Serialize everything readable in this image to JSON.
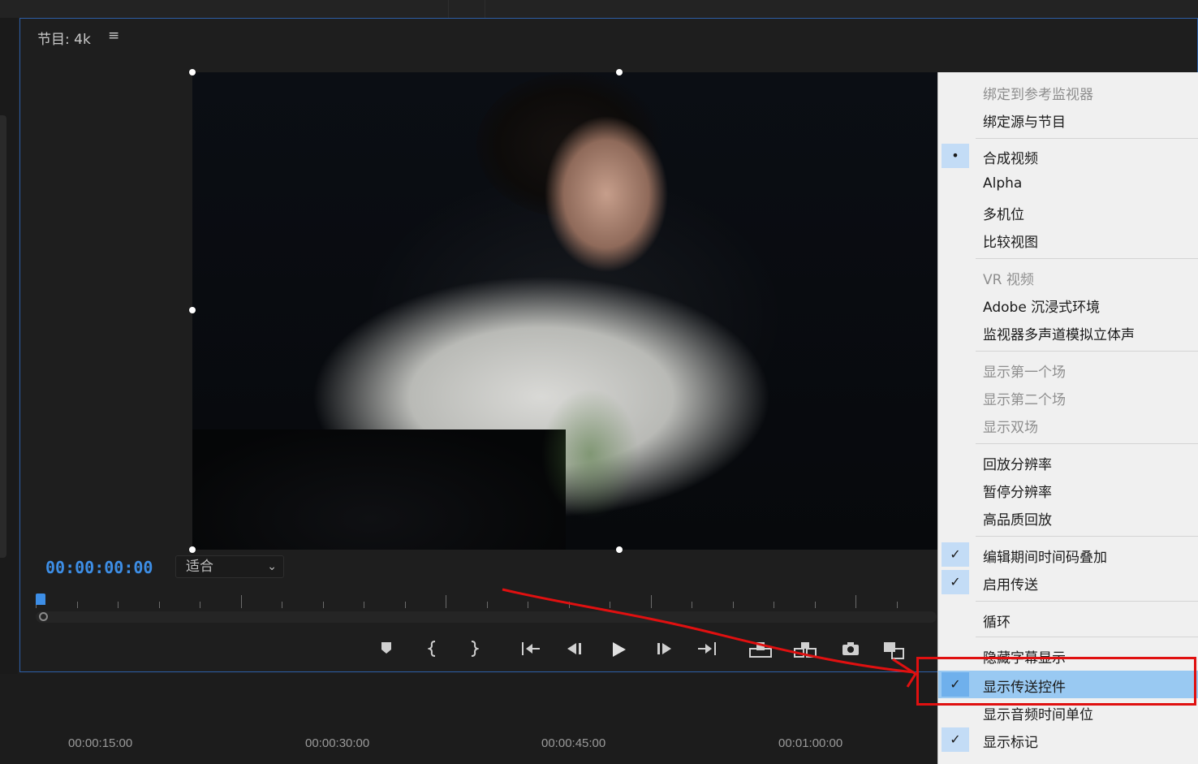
{
  "panel": {
    "title": "节目: 4k",
    "menu_icon": "≡"
  },
  "monitor": {
    "timecode": "00:00:00:00",
    "fit_label": "适合",
    "fit_chevron": "chevron-down-icon"
  },
  "controls": [
    {
      "name": "add-marker-button",
      "icon": "marker-icon"
    },
    {
      "name": "mark-in-button",
      "icon": "mark-in-icon"
    },
    {
      "name": "mark-out-button",
      "icon": "mark-out-icon"
    },
    {
      "name": "go-to-in-button",
      "icon": "go-to-in-icon"
    },
    {
      "name": "step-back-button",
      "icon": "step-back-icon"
    },
    {
      "name": "play-button",
      "icon": "play-icon"
    },
    {
      "name": "step-forward-button",
      "icon": "step-forward-icon"
    },
    {
      "name": "go-to-out-button",
      "icon": "go-to-out-icon"
    },
    {
      "name": "lift-button",
      "icon": "lift-icon"
    },
    {
      "name": "extract-button",
      "icon": "extract-icon"
    },
    {
      "name": "export-frame-button",
      "icon": "camera-icon"
    },
    {
      "name": "comparison-view-button",
      "icon": "comparison-view-icon"
    }
  ],
  "timeline": {
    "labels": [
      "00:00:15:00",
      "00:00:30:00",
      "00:00:45:00",
      "00:01:00:00"
    ]
  },
  "context_menu": {
    "items": [
      {
        "label": "绑定到参考监视器",
        "disabled": true
      },
      {
        "label": "绑定源与节目"
      },
      {
        "label": "合成视频",
        "mark": "•"
      },
      {
        "label": "Alpha"
      },
      {
        "label": "多机位"
      },
      {
        "label": "比较视图"
      },
      {
        "label": "VR 视频",
        "disabled": true
      },
      {
        "label": "Adobe 沉浸式环境"
      },
      {
        "label": "监视器多声道模拟立体声"
      },
      {
        "label": "显示第一个场",
        "disabled": true
      },
      {
        "label": "显示第二个场",
        "disabled": true
      },
      {
        "label": "显示双场",
        "disabled": true
      },
      {
        "label": "回放分辨率"
      },
      {
        "label": "暂停分辨率"
      },
      {
        "label": "高品质回放"
      },
      {
        "label": "编辑期间时间码叠加",
        "mark": "✓"
      },
      {
        "label": "启用传送",
        "mark": "✓"
      },
      {
        "label": "循环"
      },
      {
        "label": "隐藏字幕显示"
      },
      {
        "label": "显示传送控件",
        "mark": "✓",
        "highlighted": true
      },
      {
        "label": "显示音频时间单位"
      },
      {
        "label": "显示标记",
        "mark": "✓"
      }
    ]
  },
  "colors": {
    "accent": "#3d8ee6",
    "menu_bg": "#f0f0f0",
    "menu_highlight": "#99c9f2",
    "annotation_red": "#e01010"
  }
}
